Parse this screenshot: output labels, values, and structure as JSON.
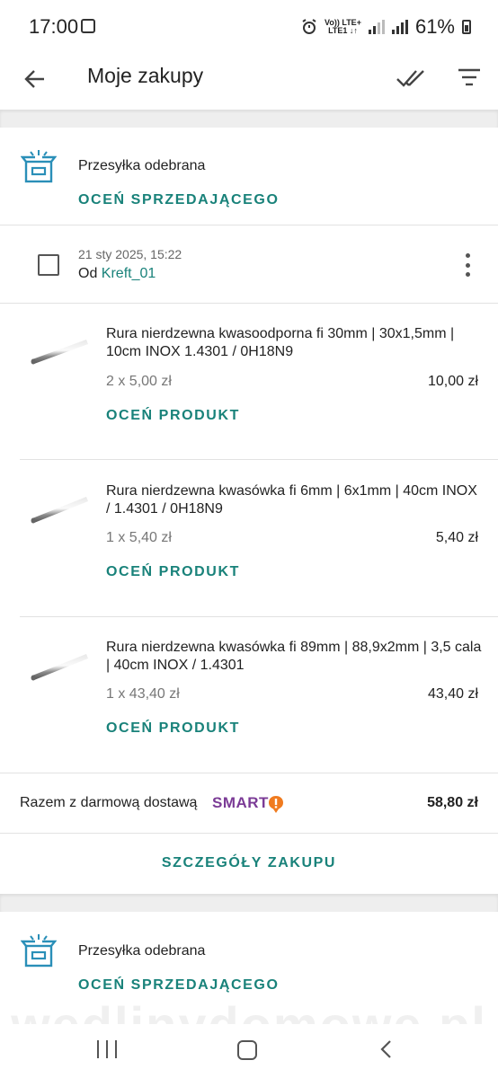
{
  "status_bar": {
    "time": "17:00",
    "net_top": "Vo)) LTE+",
    "net_bottom": "LTE1 ↓↑",
    "battery": "61%"
  },
  "app_bar": {
    "title": "Moje zakupy",
    "icons": [
      "back-arrow-icon",
      "double-check-icon",
      "filter-icon"
    ]
  },
  "shipments": [
    {
      "status": "Przesyłka odebrana",
      "rate_seller_label": "OCEŃ SPRZEDAJĄCEGO"
    },
    {
      "status": "Przesyłka odebrana",
      "rate_seller_label": "OCEŃ SPRZEDAJĄCEGO"
    }
  ],
  "order": {
    "date": "21 sty 2025, 15:22",
    "from_prefix": "Od",
    "seller": "Kreft_01",
    "products": [
      {
        "title": "Rura nierdzewna kwasoodporna fi 30mm | 30x1,5mm | 10cm INOX 1.4301 / 0H18N9",
        "qty": "2 x 5,00 zł",
        "price": "10,00 zł",
        "rate_label": "OCEŃ PRODUKT"
      },
      {
        "title": "Rura nierdzewna kwasówka fi 6mm | 6x1mm | 40cm INOX / 1.4301 / 0H18N9",
        "qty": "1 x 5,40 zł",
        "price": "5,40 zł",
        "rate_label": "OCEŃ PRODUKT"
      },
      {
        "title": "Rura nierdzewna kwasówka fi 89mm | 88,9x2mm | 3,5 cala | 40cm INOX / 1.4301",
        "qty": "1 x 43,40 zł",
        "price": "43,40 zł",
        "rate_label": "OCEŃ PRODUKT"
      }
    ],
    "total_label": "Razem z darmową dostawą",
    "smart_label": "SMART",
    "total_price": "58,80 zł",
    "details_label": "SZCZEGÓŁY ZAKUPU"
  },
  "watermark": "wedlinydomowe.pl",
  "colors": {
    "accent": "#19827a",
    "smart": "#7b3b96",
    "smart_badge": "#f07b1f",
    "box_icon": "#2a8fb8"
  }
}
